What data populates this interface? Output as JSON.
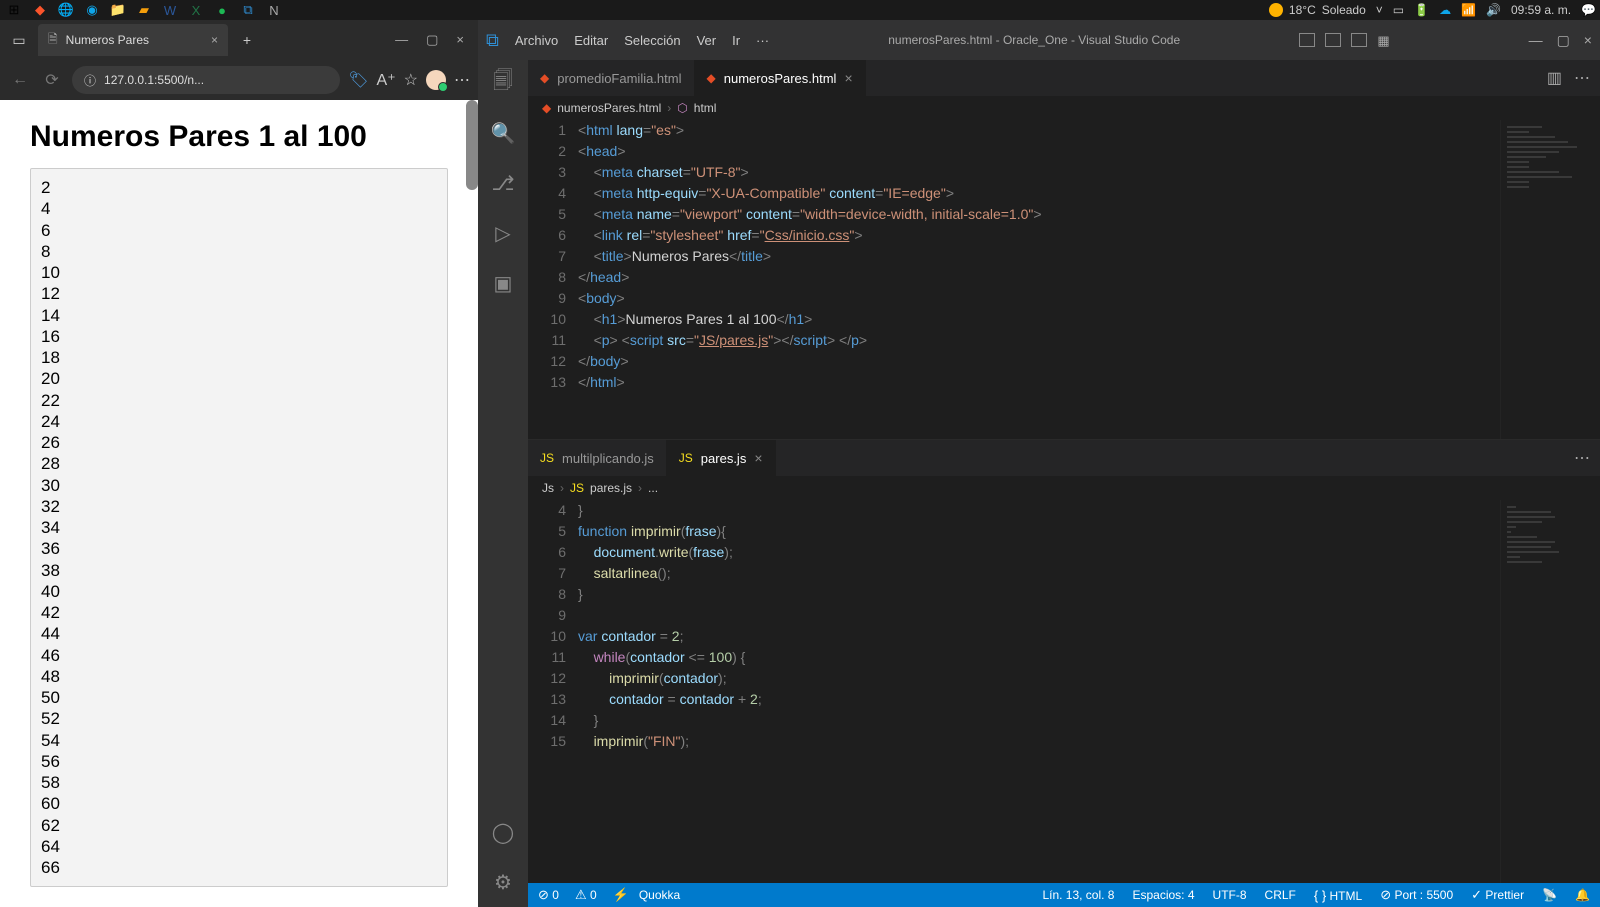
{
  "taskbar": {
    "weather_temp": "18°C",
    "weather_desc": "Soleado",
    "time": "09:59 a. m."
  },
  "browser": {
    "tab_title": "Numeros Pares",
    "url": "127.0.0.1:5500/n...",
    "page_heading": "Numeros Pares 1 al 100",
    "numbers": [
      "2",
      "4",
      "6",
      "8",
      "10",
      "12",
      "14",
      "16",
      "18",
      "20",
      "22",
      "24",
      "26",
      "28",
      "30",
      "32",
      "34",
      "36",
      "38",
      "40",
      "42",
      "44",
      "46",
      "48",
      "50",
      "52",
      "54",
      "56",
      "58",
      "60",
      "62",
      "64",
      "66"
    ]
  },
  "vscode": {
    "menu": [
      "Archivo",
      "Editar",
      "Selección",
      "Ver",
      "Ir",
      "···"
    ],
    "title": "numerosPares.html - Oracle_One - Visual Studio Code",
    "pane1": {
      "tabs": [
        {
          "icon": "html",
          "label": "promedioFamilia.html",
          "active": false,
          "close": false
        },
        {
          "icon": "html",
          "label": "numerosPares.html",
          "active": true,
          "close": true
        }
      ],
      "crumb": [
        "numerosPares.html",
        "html"
      ],
      "lines": [
        {
          "n": "1",
          "html": "<span class='punc'>&lt;</span><span class='tagn'>html</span> <span class='attr'>lang</span><span class='punc'>=</span><span class='str'>\"es\"</span><span class='punc'>&gt;</span>"
        },
        {
          "n": "2",
          "html": "<span class='punc'>&lt;</span><span class='tagn'>head</span><span class='punc'>&gt;</span>"
        },
        {
          "n": "3",
          "html": "    <span class='punc'>&lt;</span><span class='tagn'>meta</span> <span class='attr'>charset</span><span class='punc'>=</span><span class='str'>\"UTF-8\"</span><span class='punc'>&gt;</span>"
        },
        {
          "n": "4",
          "html": "    <span class='punc'>&lt;</span><span class='tagn'>meta</span> <span class='attr'>http-equiv</span><span class='punc'>=</span><span class='str'>\"X-UA-Compatible\"</span> <span class='attr'>content</span><span class='punc'>=</span><span class='str'>\"IE=edge\"</span><span class='punc'>&gt;</span>"
        },
        {
          "n": "5",
          "html": "    <span class='punc'>&lt;</span><span class='tagn'>meta</span> <span class='attr'>name</span><span class='punc'>=</span><span class='str'>\"viewport\"</span> <span class='attr'>content</span><span class='punc'>=</span><span class='str'>\"width=device-width, initial-scale=1.0\"</span><span class='punc'>&gt;</span>"
        },
        {
          "n": "6",
          "html": "    <span class='punc'>&lt;</span><span class='tagn'>link</span> <span class='attr'>rel</span><span class='punc'>=</span><span class='str'>\"stylesheet\"</span> <span class='attr'>href</span><span class='punc'>=</span><span class='str'>\"</span><span class='link'>Css/inicio.css</span><span class='str'>\"</span><span class='punc'>&gt;</span>"
        },
        {
          "n": "7",
          "html": "    <span class='punc'>&lt;</span><span class='tagn'>title</span><span class='punc'>&gt;</span><span class='txt'>Numeros Pares</span><span class='punc'>&lt;/</span><span class='tagn'>title</span><span class='punc'>&gt;</span>"
        },
        {
          "n": "8",
          "html": "<span class='punc'>&lt;/</span><span class='tagn'>head</span><span class='punc'>&gt;</span>"
        },
        {
          "n": "9",
          "html": "<span class='punc'>&lt;</span><span class='tagn'>body</span><span class='punc'>&gt;</span>"
        },
        {
          "n": "10",
          "html": "    <span class='punc'>&lt;</span><span class='tagn'>h1</span><span class='punc'>&gt;</span><span class='txt'>Numeros Pares 1 al 100</span><span class='punc'>&lt;/</span><span class='tagn'>h1</span><span class='punc'>&gt;</span>"
        },
        {
          "n": "11",
          "html": "    <span class='punc'>&lt;</span><span class='tagn'>p</span><span class='punc'>&gt;</span> <span class='punc'>&lt;</span><span class='tagn'>script</span> <span class='attr'>src</span><span class='punc'>=</span><span class='str'>\"</span><span class='link'>JS/pares.js</span><span class='str'>\"</span><span class='punc'>&gt;&lt;/</span><span class='tagn'>script</span><span class='punc'>&gt;</span> <span class='punc'>&lt;/</span><span class='tagn'>p</span><span class='punc'>&gt;</span>"
        },
        {
          "n": "12",
          "html": "<span class='punc'>&lt;/</span><span class='tagn'>body</span><span class='punc'>&gt;</span>"
        },
        {
          "n": "13",
          "html": "<span class='punc'>&lt;/</span><span class='tagn'>html</span><span class='punc'>&gt;</span>"
        }
      ]
    },
    "pane2": {
      "tabs": [
        {
          "icon": "js",
          "label": "multilplicando.js",
          "active": false,
          "close": false
        },
        {
          "icon": "js",
          "label": "pares.js",
          "active": true,
          "close": true
        }
      ],
      "crumb": [
        "Js",
        "pares.js",
        "..."
      ],
      "lines": [
        {
          "n": "4",
          "html": "<span class='punc'>}</span>"
        },
        {
          "n": "5",
          "html": "<span class='kw'>function</span> <span class='fn'>imprimir</span><span class='punc'>(</span><span class='var'>frase</span><span class='punc'>){</span>"
        },
        {
          "n": "6",
          "html": "    <span class='var'>document</span><span class='punc'>.</span><span class='fn'>write</span><span class='punc'>(</span><span class='var'>frase</span><span class='punc'>);</span>"
        },
        {
          "n": "7",
          "html": "    <span class='fn'>saltarlinea</span><span class='punc'>();</span>"
        },
        {
          "n": "8",
          "html": "<span class='punc'>}</span>"
        },
        {
          "n": "9",
          "html": " "
        },
        {
          "n": "10",
          "html": "<span class='kw'>var</span> <span class='var'>contador</span> <span class='punc'>=</span> <span class='num'>2</span><span class='punc'>;</span>"
        },
        {
          "n": "11",
          "html": "    <span class='kw2'>while</span><span class='punc'>(</span><span class='var'>contador</span> <span class='punc'>&lt;=</span> <span class='num'>100</span><span class='punc'>) {</span>"
        },
        {
          "n": "12",
          "html": "        <span class='fn'>imprimir</span><span class='punc'>(</span><span class='var'>contador</span><span class='punc'>);</span>"
        },
        {
          "n": "13",
          "html": "        <span class='var'>contador</span> <span class='punc'>=</span> <span class='var'>contador</span> <span class='punc'>+</span> <span class='num'>2</span><span class='punc'>;</span>"
        },
        {
          "n": "14",
          "html": "    <span class='punc'>}</span>"
        },
        {
          "n": "15",
          "html": "    <span class='fn'>imprimir</span><span class='punc'>(</span><span class='str'>\"FIN\"</span><span class='punc'>);</span>"
        }
      ]
    },
    "status": {
      "errors": "0",
      "warnings": "0",
      "quokka": "Quokka",
      "pos": "Lín. 13, col. 8",
      "spaces": "Espacios: 4",
      "enc": "UTF-8",
      "eol": "CRLF",
      "lang": "HTML",
      "port": "Port : 5500",
      "prettier": "Prettier"
    }
  }
}
